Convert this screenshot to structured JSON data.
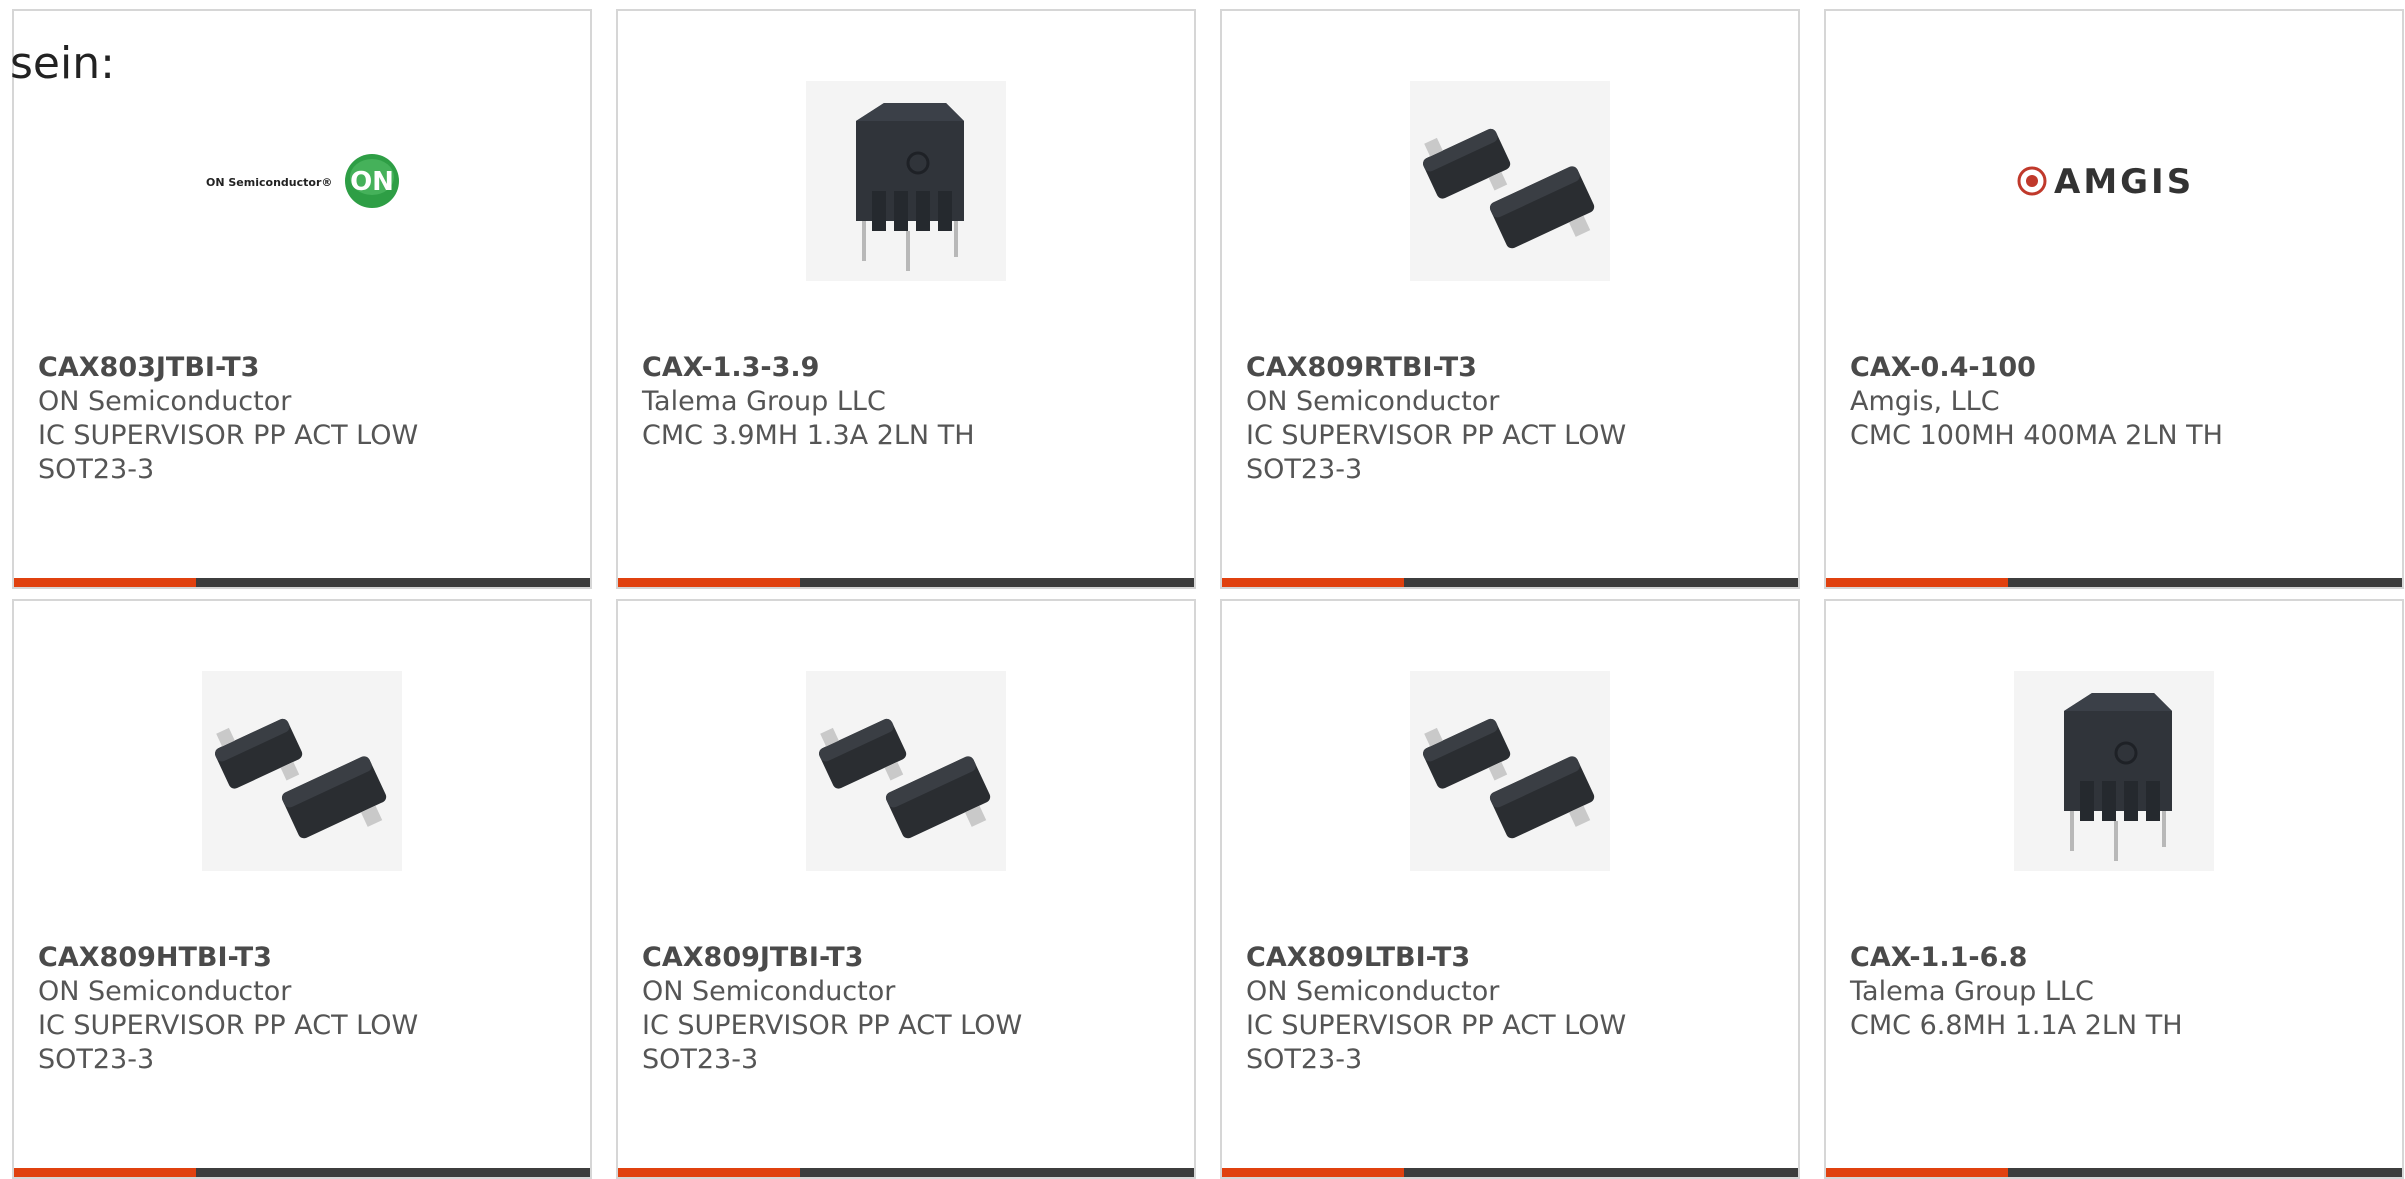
{
  "page": {
    "intro_text": "sein:"
  },
  "colors": {
    "accent_red": "#e0410f",
    "accent_dark": "#3d3d3d",
    "on_green": "#2e9e45",
    "amgis_red": "#c0392b"
  },
  "cards": [
    {
      "part": "CAX803JTBI-T3",
      "manufacturer": "ON Semiconductor",
      "desc1": "IC SUPERVISOR PP ACT LOW",
      "desc2": "SOT23-3",
      "image": "on-semiconductor-logo",
      "logo_text": "ON Semiconductor®",
      "logo_badge": "ON"
    },
    {
      "part": "CAX-1.3-3.9",
      "manufacturer": "Talema Group LLC",
      "desc1": "CMC 3.9MH 1.3A 2LN TH",
      "desc2": "",
      "image": "choke-component-photo"
    },
    {
      "part": "CAX809RTBI-T3",
      "manufacturer": "ON Semiconductor",
      "desc1": "IC SUPERVISOR PP ACT LOW",
      "desc2": "SOT23-3",
      "image": "sot23-package-photo"
    },
    {
      "part": "CAX-0.4-100",
      "manufacturer": "Amgis, LLC",
      "desc1": "CMC 100MH 400MA 2LN TH",
      "desc2": "",
      "image": "amgis-logo",
      "logo_text": "AMGIS"
    },
    {
      "part": "CAX809HTBI-T3",
      "manufacturer": "ON Semiconductor",
      "desc1": "IC SUPERVISOR PP ACT LOW",
      "desc2": "SOT23-3",
      "image": "sot23-package-photo"
    },
    {
      "part": "CAX809JTBI-T3",
      "manufacturer": "ON Semiconductor",
      "desc1": "IC SUPERVISOR PP ACT LOW",
      "desc2": "SOT23-3",
      "image": "sot23-package-photo"
    },
    {
      "part": "CAX809LTBI-T3",
      "manufacturer": "ON Semiconductor",
      "desc1": "IC SUPERVISOR PP ACT LOW",
      "desc2": "SOT23-3",
      "image": "sot23-package-photo"
    },
    {
      "part": "CAX-1.1-6.8",
      "manufacturer": "Talema Group LLC",
      "desc1": "CMC 6.8MH 1.1A 2LN TH",
      "desc2": "",
      "image": "choke-component-photo"
    }
  ]
}
